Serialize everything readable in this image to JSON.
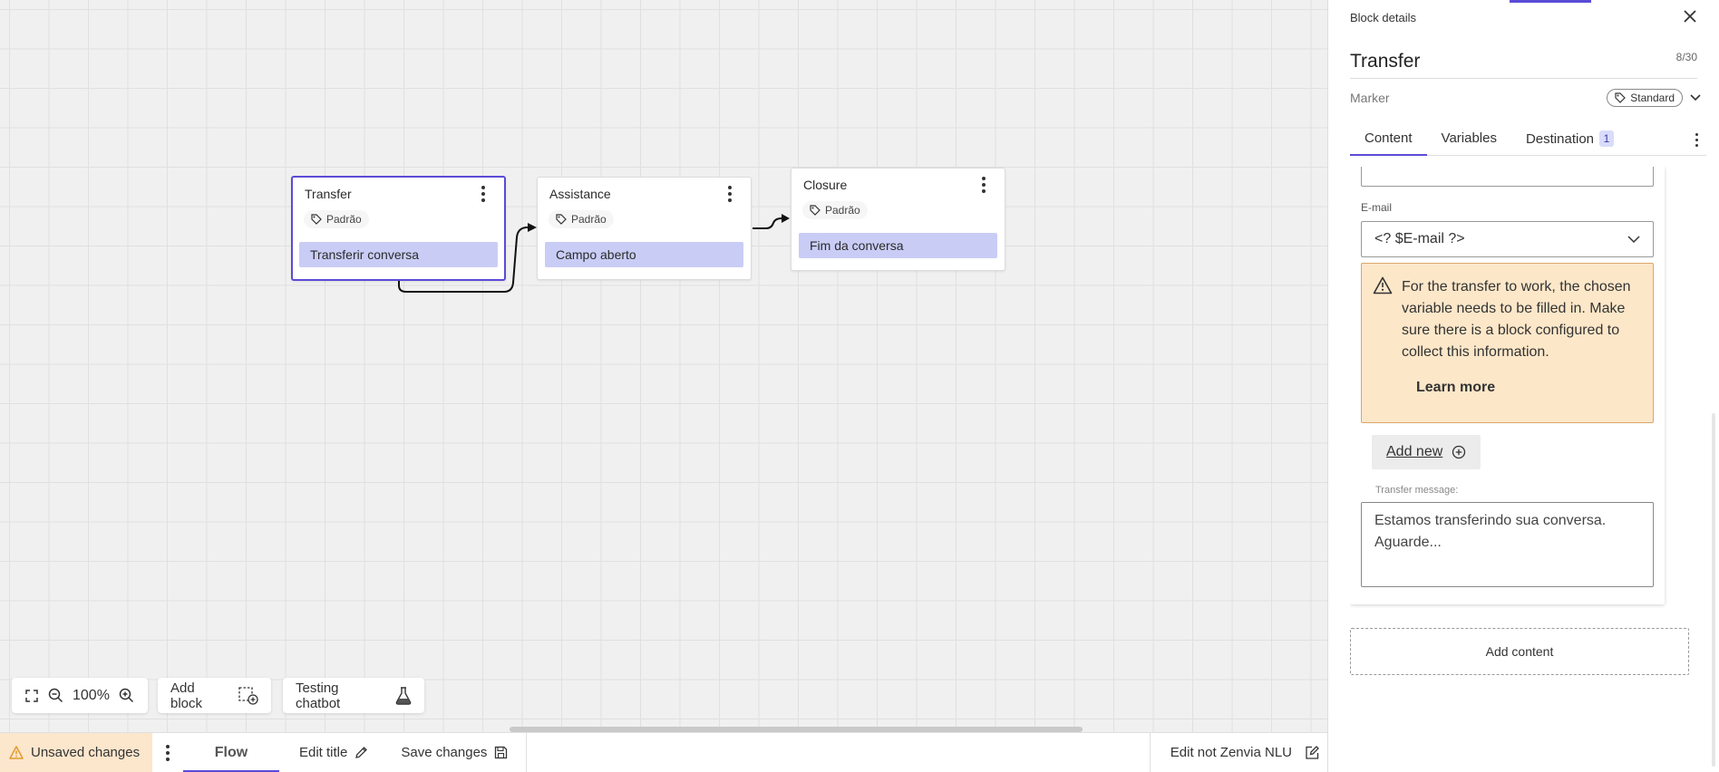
{
  "canvas": {
    "blocks": [
      {
        "title": "Transfer",
        "tag": "Padrão",
        "content": "Transferir conversa"
      },
      {
        "title": "Assistance",
        "tag": "Padrão",
        "content": "Campo aberto"
      },
      {
        "title": "Closure",
        "tag": "Padrão",
        "content": "Fim da conversa"
      }
    ],
    "toolbar": {
      "zoom_level": "100%",
      "add_block_label": "Add block",
      "testing_label": "Testing chatbot"
    }
  },
  "bottombar": {
    "unsaved_label": "Unsaved changes",
    "flow_tab": "Flow",
    "edit_title": "Edit title",
    "save_changes": "Save changes",
    "edit_nlu": "Edit not Zenvia NLU"
  },
  "panel": {
    "header": "Block details",
    "title": "Transfer",
    "char_count": "8/30",
    "marker_label": "Marker",
    "marker_value": "Standard",
    "tabs": [
      {
        "label": "Content"
      },
      {
        "label": "Variables"
      },
      {
        "label": "Destination",
        "badge": "1"
      }
    ],
    "email_label": "E-mail",
    "email_value": "<? $E-mail ?>",
    "warning_text": "For the transfer to work, the chosen variable needs to be filled in. Make sure there is a block configured to collect this information.",
    "learn_more": "Learn more",
    "add_new": "Add new",
    "transfer_message_label": "Transfer message:",
    "transfer_message_value": "Estamos transferindo sua conversa. Aguarde...",
    "add_content": "Add content"
  },
  "colors": {
    "accent": "#5b4bd6",
    "chip": "#c9cdf6",
    "warning_bg": "#fde7c9",
    "unsaved_bg": "#fce6cc"
  },
  "icons": [
    "tag-icon",
    "kebab-icon",
    "fullscreen-icon",
    "zoom-out-icon",
    "zoom-in-icon",
    "add-block-icon",
    "flask-icon",
    "warning-icon",
    "pencil-icon",
    "save-icon",
    "edit-icon",
    "close-icon",
    "chevron-down-icon",
    "plus-circle-icon"
  ]
}
